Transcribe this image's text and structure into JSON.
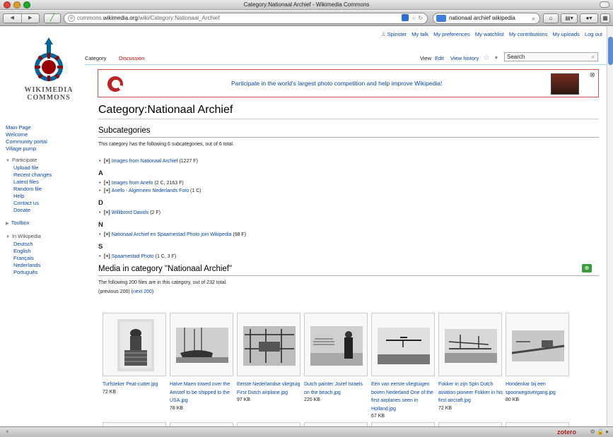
{
  "window": {
    "title": "Category:Nationaal Archief - Wikimedia Commons"
  },
  "toolbar": {
    "url_prefix": "commons.",
    "url_domain": "wikimedia.org",
    "url_path": "/wiki/Category:Nationaal_Archief",
    "search_value": "nationaal archief wikipedia"
  },
  "personal": {
    "items": [
      "Spinster",
      "My talk",
      "My preferences",
      "My watchlist",
      "My contributions",
      "My uploads",
      "Log out"
    ]
  },
  "logo": {
    "line1": "WIKIMEDIA",
    "line2": "COMMONS",
    "brand_red": "#990000",
    "brand_blue": "#006699"
  },
  "sidebar": {
    "nav": [
      "Main Page",
      "Welcome",
      "Community portal",
      "Village pump"
    ],
    "participate_label": "Participate",
    "participate": [
      "Upload file",
      "Recent changes",
      "Latest files",
      "Random file",
      "Help",
      "Contact us",
      "Donate"
    ],
    "toolbox_label": "Toolbox",
    "inwiki_label": "In Wikipedia",
    "languages": [
      "Deutsch",
      "English",
      "Français",
      "Nederlands",
      "Português"
    ]
  },
  "tabs": {
    "category": "Category",
    "discussion": "Discussion",
    "view": "View",
    "edit": "Edit",
    "history": "View history",
    "search_placeholder": "Search"
  },
  "banner": {
    "text": "Participate in the world's largest photo competition and help improve Wikipedia!"
  },
  "page": {
    "title": "Category:Nationaal Archief",
    "subcat_heading": "Subcategories",
    "subcat_summary": "This category has the following 6 subcategories, out of 6 total.",
    "groups": [
      {
        "letter": "",
        "items": [
          {
            "mark": "[×]",
            "link": "Images from Nationaal Archief",
            "count": " (1227 F)"
          }
        ]
      },
      {
        "letter": "A",
        "items": [
          {
            "mark": "[+]",
            "link": "Images from Anefo",
            "count": " (2 C, 2163 F)"
          },
          {
            "mark": "[+]",
            "link": "Anefo - Algemeen Nederlands Foto",
            "count": " (1 C)"
          }
        ]
      },
      {
        "letter": "D",
        "items": [
          {
            "mark": "[×]",
            "link": "Willibrord Davids",
            "count": " (2 F)"
          }
        ]
      },
      {
        "letter": "N",
        "items": [
          {
            "mark": "[×]",
            "link": "Nationaal Archief en Spaarnestad Photo join Wikipedia",
            "count": " (98 F)"
          }
        ]
      },
      {
        "letter": "S",
        "items": [
          {
            "mark": "[+]",
            "link": "Spaarnestad Photo",
            "count": " (1 C, 3 F)"
          }
        ]
      }
    ],
    "media_heading": "Media in category \"Nationaal Archief\"",
    "media_summary": "The following 200 files are in this category, out of 232 total.",
    "prev_text": "(previous 200) (",
    "next_link": "next 200",
    "next_close": ")"
  },
  "gallery": [
    {
      "caption": "Turfsteker Peat-cutter.jpg",
      "size": "72 KB"
    },
    {
      "caption": "Halve Maen towed over the Amstel to be shipped to the USA.jpg",
      "size": "78 KB"
    },
    {
      "caption": "Eerste Nederlandse vliegtuig First Dutch airplane.jpg",
      "size": "97 KB"
    },
    {
      "caption": "Dutch painter Jozef Israels on the beach.jpg",
      "size": "220 KB"
    },
    {
      "caption": "Eén van eerste vliegtuigen boven Nederland One of the first airplanes seen in Holland.jpg",
      "size": "67 KB"
    },
    {
      "caption": "Fokker in zijn Spin Dutch aviation pioneer Fokker in his first aircraft.jpg",
      "size": "72 KB"
    },
    {
      "caption": "Hondenkar bij een spoorwegovergang.jpg",
      "size": "80 KB"
    }
  ],
  "statusbar": {
    "zotero": "zotero"
  }
}
